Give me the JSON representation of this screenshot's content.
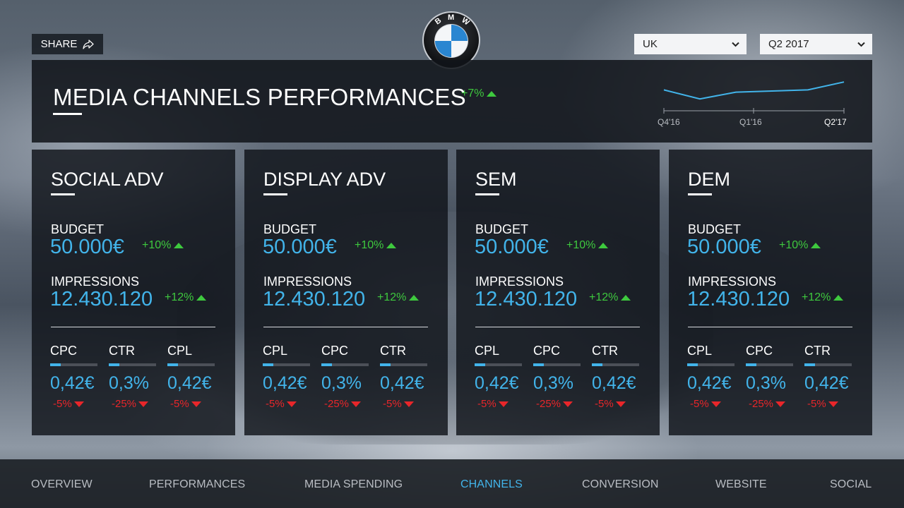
{
  "topbar": {
    "share_label": "SHARE",
    "share_icon": "share-arrow-icon",
    "logo_text": "BMW",
    "country_select": {
      "value": "UK",
      "icon": "chevron-down-icon"
    },
    "period_select": {
      "value": "Q2 2017",
      "icon": "chevron-down-icon"
    }
  },
  "header": {
    "title": "MEDIA CHANNELS PERFORMANCES",
    "change": "+7%",
    "change_direction": "up",
    "sparkline": {
      "type": "line",
      "x_labels": [
        "Q4'16",
        "Q1'16",
        "Q2'17"
      ],
      "values": [
        0.55,
        0.15,
        0.45,
        0.5,
        0.55,
        0.9
      ],
      "line_color": "#42b4ea"
    }
  },
  "cards": [
    {
      "title": "SOCIAL ADV",
      "budget_label": "BUDGET",
      "budget_value": "50.000€",
      "budget_change": "+10%",
      "impressions_label": "IMPRESSIONS",
      "impressions_value": "12.430.120",
      "impressions_change": "+12%",
      "kpis": [
        {
          "label": "CPC",
          "value": "0,42€",
          "change": "-5%",
          "fill": 0.22
        },
        {
          "label": "CTR",
          "value": "0,3%",
          "change": "-25%",
          "fill": 0.22
        },
        {
          "label": "CPL",
          "value": "0,42€",
          "change": "-5%",
          "fill": 0.22
        }
      ]
    },
    {
      "title": "DISPLAY ADV",
      "budget_label": "BUDGET",
      "budget_value": "50.000€",
      "budget_change": "+10%",
      "impressions_label": "IMPRESSIONS",
      "impressions_value": "12.430.120",
      "impressions_change": "+12%",
      "kpis": [
        {
          "label": "CPL",
          "value": "0,42€",
          "change": "-5%",
          "fill": 0.22
        },
        {
          "label": "CPC",
          "value": "0,3%",
          "change": "-25%",
          "fill": 0.22
        },
        {
          "label": "CTR",
          "value": "0,42€",
          "change": "-5%",
          "fill": 0.22
        }
      ]
    },
    {
      "title": "SEM",
      "budget_label": "BUDGET",
      "budget_value": "50.000€",
      "budget_change": "+10%",
      "impressions_label": "IMPRESSIONS",
      "impressions_value": "12.430.120",
      "impressions_change": "+12%",
      "kpis": [
        {
          "label": "CPL",
          "value": "0,42€",
          "change": "-5%",
          "fill": 0.22
        },
        {
          "label": "CPC",
          "value": "0,3%",
          "change": "-25%",
          "fill": 0.22
        },
        {
          "label": "CTR",
          "value": "0,42€",
          "change": "-5%",
          "fill": 0.22
        }
      ]
    },
    {
      "title": "DEM",
      "budget_label": "BUDGET",
      "budget_value": "50.000€",
      "budget_change": "+10%",
      "impressions_label": "IMPRESSIONS",
      "impressions_value": "12.430.120",
      "impressions_change": "+12%",
      "kpis": [
        {
          "label": "CPL",
          "value": "0,42€",
          "change": "-5%",
          "fill": 0.22
        },
        {
          "label": "CPC",
          "value": "0,3%",
          "change": "-25%",
          "fill": 0.22
        },
        {
          "label": "CTR",
          "value": "0,42€",
          "change": "-5%",
          "fill": 0.22
        }
      ]
    }
  ],
  "nav": {
    "items": [
      {
        "label": "OVERVIEW",
        "active": false
      },
      {
        "label": "PERFORMANCES",
        "active": false
      },
      {
        "label": "MEDIA SPENDING",
        "active": false
      },
      {
        "label": "CHANNELS",
        "active": true
      },
      {
        "label": "CONVERSION",
        "active": false
      },
      {
        "label": "WEBSITE",
        "active": false
      },
      {
        "label": "SOCIAL",
        "active": false
      }
    ]
  },
  "colors": {
    "accent": "#42b4ea",
    "positive": "#3ec93e",
    "negative": "#e8262a"
  }
}
